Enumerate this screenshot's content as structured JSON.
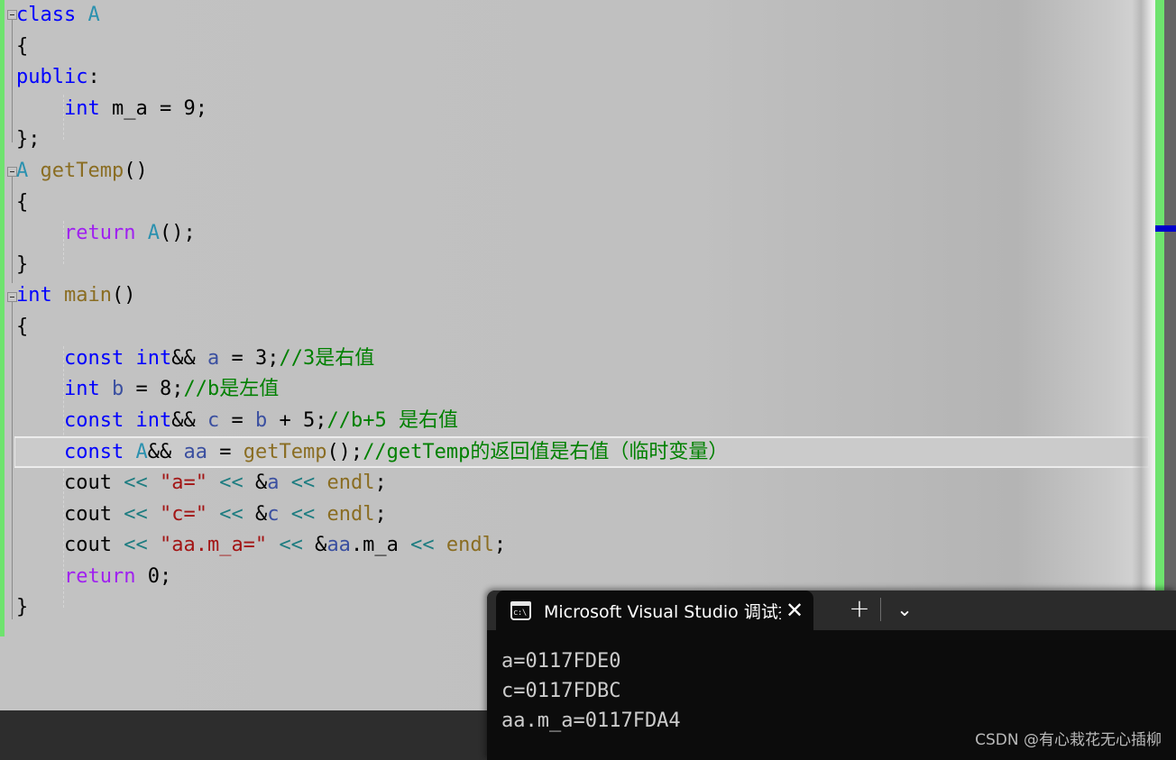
{
  "editor": {
    "background_color": "#c0c0c0",
    "change_bar_color": "#6ee36e",
    "current_line_index": 14,
    "syntax_colors": {
      "keyword": "#0000ff",
      "type": "#2b91af",
      "function": "#8a6d22",
      "string": "#a31515",
      "comment": "#008000",
      "operator": "#1d7c80",
      "control": "#a020f0",
      "variable": "#3a4fa0",
      "plain": "#000000"
    },
    "lines": [
      {
        "fold": true,
        "tokens": [
          {
            "t": "class",
            "c": "kw"
          },
          {
            "t": " ",
            "c": "plain"
          },
          {
            "t": "A",
            "c": "type"
          }
        ]
      },
      {
        "fold": false,
        "tokens": [
          {
            "t": "{",
            "c": "plain"
          }
        ]
      },
      {
        "fold": false,
        "tokens": [
          {
            "t": "public",
            "c": "kw"
          },
          {
            "t": ":",
            "c": "plain"
          }
        ]
      },
      {
        "fold": false,
        "tokens": [
          {
            "t": "    ",
            "c": "plain"
          },
          {
            "t": "int",
            "c": "kw"
          },
          {
            "t": " m_a = ",
            "c": "plain"
          },
          {
            "t": "9",
            "c": "num"
          },
          {
            "t": ";",
            "c": "plain"
          }
        ]
      },
      {
        "fold": false,
        "tokens": [
          {
            "t": "};",
            "c": "plain"
          }
        ]
      },
      {
        "fold": true,
        "tokens": [
          {
            "t": "A",
            "c": "type"
          },
          {
            "t": " ",
            "c": "plain"
          },
          {
            "t": "getTemp",
            "c": "fn"
          },
          {
            "t": "()",
            "c": "plain"
          }
        ]
      },
      {
        "fold": false,
        "tokens": [
          {
            "t": "{",
            "c": "plain"
          }
        ]
      },
      {
        "fold": false,
        "tokens": [
          {
            "t": "    ",
            "c": "plain"
          },
          {
            "t": "return",
            "c": "ctl"
          },
          {
            "t": " ",
            "c": "plain"
          },
          {
            "t": "A",
            "c": "type"
          },
          {
            "t": "();",
            "c": "plain"
          }
        ]
      },
      {
        "fold": false,
        "tokens": [
          {
            "t": "}",
            "c": "plain"
          }
        ]
      },
      {
        "fold": true,
        "tokens": [
          {
            "t": "int",
            "c": "kw"
          },
          {
            "t": " ",
            "c": "plain"
          },
          {
            "t": "main",
            "c": "fn"
          },
          {
            "t": "()",
            "c": "plain"
          }
        ]
      },
      {
        "fold": false,
        "tokens": [
          {
            "t": "{",
            "c": "plain"
          }
        ]
      },
      {
        "fold": false,
        "tokens": [
          {
            "t": "    ",
            "c": "plain"
          },
          {
            "t": "const",
            "c": "kw"
          },
          {
            "t": " ",
            "c": "plain"
          },
          {
            "t": "int",
            "c": "kw"
          },
          {
            "t": "&& ",
            "c": "plain"
          },
          {
            "t": "a",
            "c": "var"
          },
          {
            "t": " = ",
            "c": "plain"
          },
          {
            "t": "3",
            "c": "num"
          },
          {
            "t": ";",
            "c": "plain"
          },
          {
            "t": "//3是右值",
            "c": "cmt"
          }
        ]
      },
      {
        "fold": false,
        "tokens": [
          {
            "t": "    ",
            "c": "plain"
          },
          {
            "t": "int",
            "c": "kw"
          },
          {
            "t": " ",
            "c": "plain"
          },
          {
            "t": "b",
            "c": "var"
          },
          {
            "t": " = ",
            "c": "plain"
          },
          {
            "t": "8",
            "c": "num"
          },
          {
            "t": ";",
            "c": "plain"
          },
          {
            "t": "//b是左值",
            "c": "cmt"
          }
        ]
      },
      {
        "fold": false,
        "tokens": [
          {
            "t": "    ",
            "c": "plain"
          },
          {
            "t": "const",
            "c": "kw"
          },
          {
            "t": " ",
            "c": "plain"
          },
          {
            "t": "int",
            "c": "kw"
          },
          {
            "t": "&& ",
            "c": "plain"
          },
          {
            "t": "c",
            "c": "var"
          },
          {
            "t": " = ",
            "c": "plain"
          },
          {
            "t": "b",
            "c": "var"
          },
          {
            "t": " + ",
            "c": "plain"
          },
          {
            "t": "5",
            "c": "num"
          },
          {
            "t": ";",
            "c": "plain"
          },
          {
            "t": "//b+5 是右值",
            "c": "cmt"
          }
        ]
      },
      {
        "fold": false,
        "current": true,
        "tokens": [
          {
            "t": "    ",
            "c": "plain"
          },
          {
            "t": "const",
            "c": "kw"
          },
          {
            "t": " ",
            "c": "plain"
          },
          {
            "t": "A",
            "c": "type"
          },
          {
            "t": "&& ",
            "c": "plain"
          },
          {
            "t": "aa",
            "c": "var"
          },
          {
            "t": " = ",
            "c": "plain"
          },
          {
            "t": "getTemp",
            "c": "fn"
          },
          {
            "t": "();",
            "c": "plain"
          },
          {
            "t": "//getTemp的返回值是右值（临时变量）",
            "c": "cmt"
          }
        ]
      },
      {
        "fold": false,
        "tokens": [
          {
            "t": "    cout ",
            "c": "plain"
          },
          {
            "t": "<<",
            "c": "op"
          },
          {
            "t": " ",
            "c": "plain"
          },
          {
            "t": "\"a=\"",
            "c": "str"
          },
          {
            "t": " ",
            "c": "plain"
          },
          {
            "t": "<<",
            "c": "op"
          },
          {
            "t": " &",
            "c": "plain"
          },
          {
            "t": "a",
            "c": "var"
          },
          {
            "t": " ",
            "c": "plain"
          },
          {
            "t": "<<",
            "c": "op"
          },
          {
            "t": " ",
            "c": "plain"
          },
          {
            "t": "endl",
            "c": "fn"
          },
          {
            "t": ";",
            "c": "plain"
          }
        ]
      },
      {
        "fold": false,
        "tokens": [
          {
            "t": "    cout ",
            "c": "plain"
          },
          {
            "t": "<<",
            "c": "op"
          },
          {
            "t": " ",
            "c": "plain"
          },
          {
            "t": "\"c=\"",
            "c": "str"
          },
          {
            "t": " ",
            "c": "plain"
          },
          {
            "t": "<<",
            "c": "op"
          },
          {
            "t": " &",
            "c": "plain"
          },
          {
            "t": "c",
            "c": "var"
          },
          {
            "t": " ",
            "c": "plain"
          },
          {
            "t": "<<",
            "c": "op"
          },
          {
            "t": " ",
            "c": "plain"
          },
          {
            "t": "endl",
            "c": "fn"
          },
          {
            "t": ";",
            "c": "plain"
          }
        ]
      },
      {
        "fold": false,
        "tokens": [
          {
            "t": "    cout ",
            "c": "plain"
          },
          {
            "t": "<<",
            "c": "op"
          },
          {
            "t": " ",
            "c": "plain"
          },
          {
            "t": "\"aa.m_a=\"",
            "c": "str"
          },
          {
            "t": " ",
            "c": "plain"
          },
          {
            "t": "<<",
            "c": "op"
          },
          {
            "t": " &",
            "c": "plain"
          },
          {
            "t": "aa",
            "c": "var"
          },
          {
            "t": ".m_a ",
            "c": "plain"
          },
          {
            "t": "<<",
            "c": "op"
          },
          {
            "t": " ",
            "c": "plain"
          },
          {
            "t": "endl",
            "c": "fn"
          },
          {
            "t": ";",
            "c": "plain"
          }
        ]
      },
      {
        "fold": false,
        "tokens": [
          {
            "t": "    ",
            "c": "plain"
          },
          {
            "t": "return",
            "c": "ctl"
          },
          {
            "t": " ",
            "c": "plain"
          },
          {
            "t": "0",
            "c": "num"
          },
          {
            "t": ";",
            "c": "plain"
          }
        ]
      },
      {
        "fold": false,
        "tokens": [
          {
            "t": "}",
            "c": "plain"
          }
        ]
      }
    ]
  },
  "scrollbar": {
    "thumb_color": "#6ee36e",
    "track_color": "#666666",
    "marker_color": "#0000cc"
  },
  "terminal": {
    "tab_title": "Microsoft Visual Studio 调试挄",
    "tab_icon_label": "c:\\",
    "close_label": "✕",
    "new_tab_label": "+",
    "dropdown_label": "⌄",
    "output_lines": [
      "a=0117FDE0",
      "c=0117FDBC",
      "aa.m_a=0117FDA4"
    ]
  },
  "watermark": {
    "text": "CSDN @有心栽花无心插柳"
  }
}
